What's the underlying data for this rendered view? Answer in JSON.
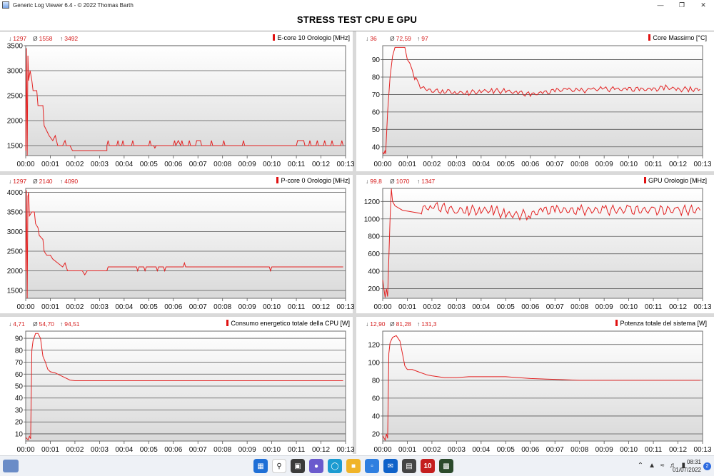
{
  "window": {
    "title": "Generic Log Viewer 6.4 - © 2022 Thomas Barth",
    "minimize_icon": "minimize-icon",
    "maximize_icon": "restore-icon",
    "close_icon": "close-icon"
  },
  "page": {
    "title": "STRESS TEST CPU E GPU"
  },
  "time_ticks": [
    "00:00",
    "00:01",
    "00:02",
    "00:03",
    "00:04",
    "00:05",
    "00:06",
    "00:07",
    "00:08",
    "00:09",
    "00:10",
    "00:11",
    "00:12",
    "00:13"
  ],
  "panels": [
    {
      "id": "ecore",
      "label": "E-core 10 Orologio [MHz]",
      "min": "1297",
      "avg": "1558",
      "max": "3492",
      "ymin": 1300,
      "ymax": 3500,
      "yticks": [
        1500,
        2000,
        2500,
        3000,
        3500
      ],
      "series": [
        [
          0,
          1400
        ],
        [
          0.03,
          3450
        ],
        [
          0.06,
          1300
        ],
        [
          0.09,
          3300
        ],
        [
          0.12,
          2800
        ],
        [
          0.18,
          3000
        ],
        [
          0.25,
          2800
        ],
        [
          0.3,
          2600
        ],
        [
          0.45,
          2600
        ],
        [
          0.5,
          2300
        ],
        [
          0.7,
          2300
        ],
        [
          0.75,
          1900
        ],
        [
          0.85,
          1800
        ],
        [
          0.95,
          1700
        ],
        [
          1.1,
          1600
        ],
        [
          1.2,
          1700
        ],
        [
          1.3,
          1500
        ],
        [
          1.5,
          1500
        ],
        [
          1.6,
          1600
        ],
        [
          1.65,
          1500
        ],
        [
          1.8,
          1500
        ],
        [
          1.9,
          1400
        ],
        [
          2.1,
          1400
        ],
        [
          3.3,
          1400
        ],
        [
          3.3,
          1500
        ],
        [
          3.35,
          1600
        ],
        [
          3.4,
          1500
        ],
        [
          3.7,
          1500
        ],
        [
          3.75,
          1600
        ],
        [
          3.8,
          1500
        ],
        [
          3.9,
          1500
        ],
        [
          3.95,
          1600
        ],
        [
          4.0,
          1500
        ],
        [
          4.3,
          1500
        ],
        [
          4.35,
          1600
        ],
        [
          4.4,
          1500
        ],
        [
          5.0,
          1500
        ],
        [
          5.05,
          1600
        ],
        [
          5.1,
          1500
        ],
        [
          5.2,
          1500
        ],
        [
          5.25,
          1450
        ],
        [
          5.3,
          1500
        ],
        [
          6.0,
          1500
        ],
        [
          6.05,
          1600
        ],
        [
          6.1,
          1500
        ],
        [
          6.2,
          1600
        ],
        [
          6.3,
          1500
        ],
        [
          6.35,
          1600
        ],
        [
          6.4,
          1500
        ],
        [
          6.6,
          1500
        ],
        [
          6.65,
          1600
        ],
        [
          6.7,
          1500
        ],
        [
          6.9,
          1500
        ],
        [
          6.95,
          1600
        ],
        [
          7.1,
          1600
        ],
        [
          7.15,
          1500
        ],
        [
          7.5,
          1500
        ],
        [
          7.55,
          1600
        ],
        [
          7.6,
          1500
        ],
        [
          8.0,
          1500
        ],
        [
          8.05,
          1600
        ],
        [
          8.1,
          1500
        ],
        [
          8.8,
          1500
        ],
        [
          8.85,
          1600
        ],
        [
          8.9,
          1500
        ],
        [
          11.0,
          1500
        ],
        [
          11.05,
          1600
        ],
        [
          11.3,
          1600
        ],
        [
          11.35,
          1500
        ],
        [
          11.5,
          1500
        ],
        [
          11.55,
          1600
        ],
        [
          11.6,
          1500
        ],
        [
          11.8,
          1500
        ],
        [
          11.85,
          1600
        ],
        [
          11.9,
          1500
        ],
        [
          12.1,
          1500
        ],
        [
          12.15,
          1600
        ],
        [
          12.2,
          1500
        ],
        [
          12.4,
          1500
        ],
        [
          12.45,
          1600
        ],
        [
          12.5,
          1500
        ],
        [
          12.8,
          1500
        ],
        [
          12.85,
          1600
        ],
        [
          12.9,
          1500
        ]
      ]
    },
    {
      "id": "coremax",
      "label": "Core Massimo [°C]",
      "min": "36",
      "avg": "72,59",
      "max": "97",
      "ymin": 35,
      "ymax": 98,
      "yticks": [
        40,
        50,
        60,
        70,
        80,
        90
      ],
      "series": [
        [
          0,
          37
        ],
        [
          0.05,
          36
        ],
        [
          0.1,
          38
        ],
        [
          0.12,
          36
        ],
        [
          0.2,
          60
        ],
        [
          0.3,
          80
        ],
        [
          0.4,
          92
        ],
        [
          0.5,
          97
        ],
        [
          0.9,
          97
        ],
        [
          1.0,
          90
        ],
        [
          1.1,
          88
        ],
        [
          1.2,
          84
        ],
        [
          1.3,
          80
        ],
        [
          1.4,
          77
        ],
        [
          1.6,
          74
        ],
        [
          1.8,
          73
        ],
        [
          2.0,
          72
        ],
        [
          2.5,
          72
        ],
        [
          3.0,
          71
        ],
        [
          3.5,
          71
        ],
        [
          4.0,
          72
        ],
        [
          4.5,
          72
        ],
        [
          5.0,
          72
        ],
        [
          5.5,
          71
        ],
        [
          6.0,
          70
        ],
        [
          6.5,
          71
        ],
        [
          7.0,
          72
        ],
        [
          7.5,
          73
        ],
        [
          8.0,
          72
        ],
        [
          8.5,
          73
        ],
        [
          9.0,
          73
        ],
        [
          9.5,
          73
        ],
        [
          10.0,
          73
        ],
        [
          10.5,
          73
        ],
        [
          11.0,
          73
        ],
        [
          11.5,
          74
        ],
        [
          12.0,
          73
        ],
        [
          12.5,
          73
        ],
        [
          12.9,
          73
        ]
      ],
      "jitter": 1.5
    },
    {
      "id": "pcore",
      "label": "P-core 0 Orologio [MHz]",
      "min": "1297",
      "avg": "2140",
      "max": "4090",
      "ymin": 1300,
      "ymax": 4100,
      "yticks": [
        1500,
        2000,
        2500,
        3000,
        3500,
        4000
      ],
      "series": [
        [
          0,
          2000
        ],
        [
          0.03,
          4050
        ],
        [
          0.06,
          1300
        ],
        [
          0.09,
          3900
        ],
        [
          0.12,
          4000
        ],
        [
          0.15,
          3400
        ],
        [
          0.25,
          3500
        ],
        [
          0.35,
          3500
        ],
        [
          0.4,
          3200
        ],
        [
          0.5,
          3100
        ],
        [
          0.55,
          2900
        ],
        [
          0.7,
          2800
        ],
        [
          0.75,
          2500
        ],
        [
          0.85,
          2400
        ],
        [
          1.0,
          2400
        ],
        [
          1.1,
          2300
        ],
        [
          1.3,
          2200
        ],
        [
          1.5,
          2100
        ],
        [
          1.6,
          2200
        ],
        [
          1.7,
          2000
        ],
        [
          2.0,
          2000
        ],
        [
          2.3,
          2000
        ],
        [
          2.4,
          1900
        ],
        [
          2.5,
          2000
        ],
        [
          3.3,
          2000
        ],
        [
          3.35,
          2100
        ],
        [
          4.5,
          2100
        ],
        [
          4.55,
          2000
        ],
        [
          4.6,
          2100
        ],
        [
          4.8,
          2100
        ],
        [
          4.85,
          2000
        ],
        [
          4.9,
          2100
        ],
        [
          5.3,
          2100
        ],
        [
          5.35,
          2000
        ],
        [
          5.4,
          2100
        ],
        [
          5.6,
          2100
        ],
        [
          5.65,
          2000
        ],
        [
          5.7,
          2100
        ],
        [
          6.4,
          2100
        ],
        [
          6.45,
          2200
        ],
        [
          6.5,
          2100
        ],
        [
          9.9,
          2100
        ],
        [
          9.95,
          2000
        ],
        [
          10.0,
          2100
        ],
        [
          12.9,
          2100
        ]
      ]
    },
    {
      "id": "gpu",
      "label": "GPU Orologio [MHz]",
      "min": "99,8",
      "avg": "1070",
      "max": "1347",
      "ymin": 90,
      "ymax": 1350,
      "yticks": [
        200,
        400,
        600,
        800,
        1000,
        1200
      ],
      "series": [
        [
          0,
          300
        ],
        [
          0.1,
          100
        ],
        [
          0.15,
          200
        ],
        [
          0.2,
          110
        ],
        [
          0.3,
          1000
        ],
        [
          0.35,
          1347
        ],
        [
          0.4,
          1200
        ],
        [
          0.5,
          1150
        ],
        [
          0.8,
          1100
        ],
        [
          1.5,
          1100
        ],
        [
          2.0,
          1150
        ],
        [
          3.0,
          1100
        ],
        [
          3.5,
          1100
        ],
        [
          4.0,
          1100
        ],
        [
          4.5,
          1100
        ],
        [
          5.0,
          1050
        ],
        [
          6.0,
          1050
        ],
        [
          6.5,
          1100
        ],
        [
          7.0,
          1100
        ],
        [
          8.0,
          1100
        ],
        [
          9.0,
          1100
        ],
        [
          10.0,
          1100
        ],
        [
          11.0,
          1100
        ],
        [
          12.0,
          1100
        ],
        [
          12.9,
          1100
        ]
      ],
      "jitter": 60
    },
    {
      "id": "cpupower",
      "label": "Consumo energetico totale della CPU [W]",
      "min": "4,71",
      "avg": "54,70",
      "max": "94,51",
      "ymin": 4,
      "ymax": 96,
      "yticks": [
        10,
        20,
        30,
        40,
        50,
        60,
        70,
        80,
        90
      ],
      "series": [
        [
          0,
          7
        ],
        [
          0.1,
          5
        ],
        [
          0.15,
          8
        ],
        [
          0.2,
          6
        ],
        [
          0.25,
          80
        ],
        [
          0.3,
          88
        ],
        [
          0.4,
          94
        ],
        [
          0.5,
          94
        ],
        [
          0.6,
          90
        ],
        [
          0.7,
          75
        ],
        [
          0.8,
          70
        ],
        [
          0.9,
          64
        ],
        [
          1.0,
          62
        ],
        [
          1.2,
          61
        ],
        [
          1.5,
          58
        ],
        [
          1.8,
          55
        ],
        [
          2.0,
          54.5
        ],
        [
          3.0,
          54.5
        ],
        [
          6.0,
          54.5
        ],
        [
          9.0,
          54.5
        ],
        [
          12.9,
          54.5
        ]
      ]
    },
    {
      "id": "syspower",
      "label": "Potenza totale del sistema [W]",
      "min": "12,90",
      "avg": "81,28",
      "max": "131,3",
      "ymin": 12,
      "ymax": 135,
      "yticks": [
        20,
        40,
        60,
        80,
        100,
        120
      ],
      "series": [
        [
          0,
          18
        ],
        [
          0.1,
          13
        ],
        [
          0.15,
          20
        ],
        [
          0.2,
          15
        ],
        [
          0.25,
          110
        ],
        [
          0.3,
          122
        ],
        [
          0.4,
          128
        ],
        [
          0.55,
          130
        ],
        [
          0.7,
          124
        ],
        [
          0.8,
          110
        ],
        [
          0.9,
          96
        ],
        [
          1.0,
          92
        ],
        [
          1.2,
          92
        ],
        [
          1.5,
          89
        ],
        [
          1.8,
          86
        ],
        [
          2.0,
          85
        ],
        [
          2.5,
          83
        ],
        [
          3.0,
          83
        ],
        [
          3.5,
          84
        ],
        [
          4.0,
          84
        ],
        [
          4.5,
          84
        ],
        [
          5.0,
          84
        ],
        [
          5.5,
          83
        ],
        [
          6.0,
          82
        ],
        [
          7.0,
          81
        ],
        [
          8.0,
          80
        ],
        [
          9.0,
          80
        ],
        [
          10.0,
          80
        ],
        [
          11.0,
          80
        ],
        [
          12.0,
          80
        ],
        [
          12.9,
          80
        ]
      ]
    }
  ],
  "taskbar": {
    "apps": [
      "start-icon",
      "search-icon",
      "task-view-icon",
      "widgets-icon",
      "teams-icon",
      "edge-icon",
      "explorer-icon",
      "store-icon",
      "mail-icon",
      "monitor-app-icon",
      "hwinfo-icon",
      "log-viewer-icon"
    ],
    "tray": [
      "chevron-up-icon",
      "network-icon",
      "wifi-icon",
      "volume-icon",
      "battery-icon"
    ],
    "time": "08:31",
    "date": "01/07/2022",
    "notifications": "2"
  }
}
